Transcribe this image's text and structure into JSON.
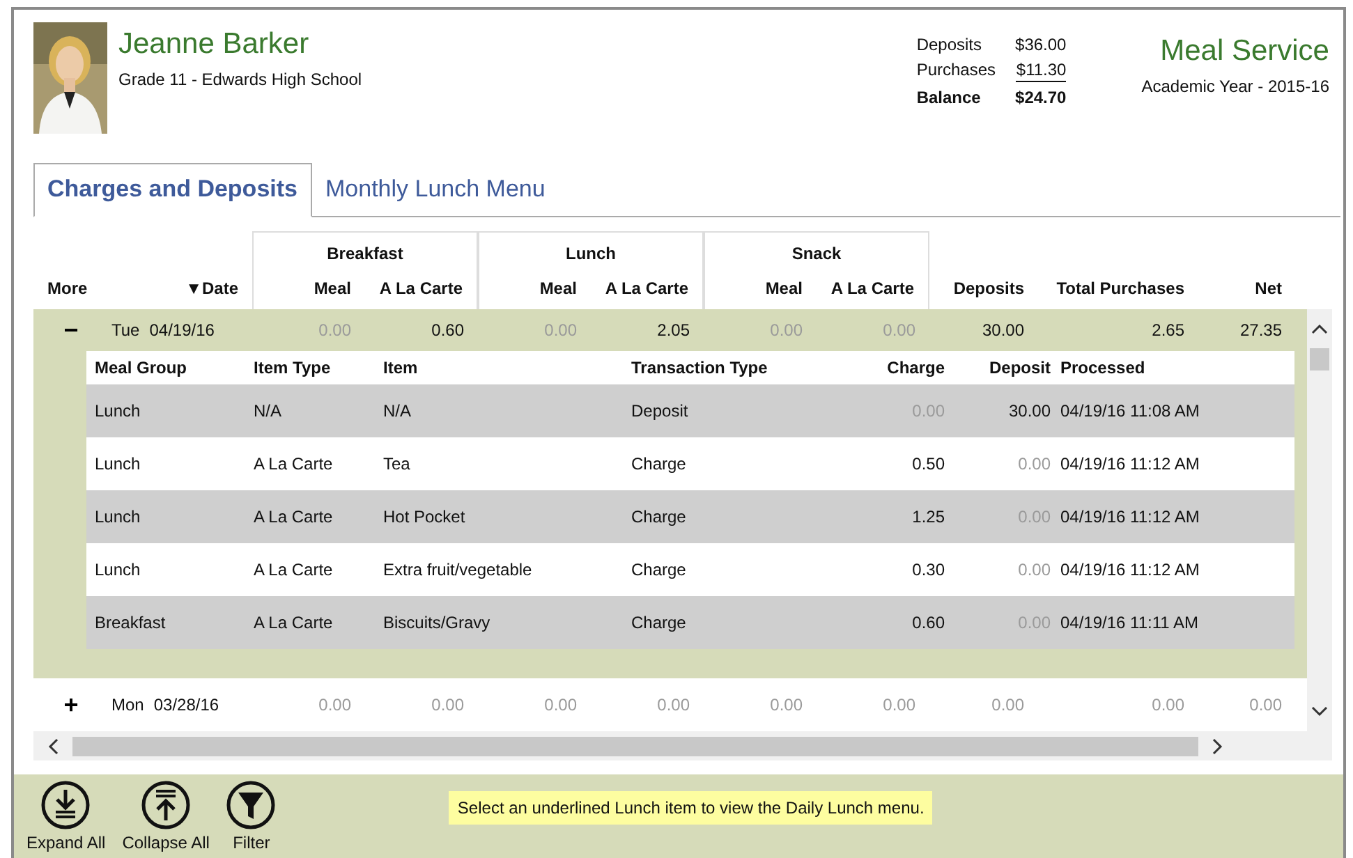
{
  "student": {
    "name": "Jeanne Barker",
    "subtitle": "Grade 11 - Edwards High School"
  },
  "summary": [
    {
      "label": "Deposits",
      "value": "$36.00",
      "underlined": false,
      "kind": "normal"
    },
    {
      "label": "Purchases",
      "value": "$11.30",
      "underlined": true,
      "kind": "normal"
    },
    {
      "label": "Balance",
      "value": "$24.70",
      "underlined": false,
      "kind": "total"
    }
  ],
  "app": {
    "title": "Meal Service",
    "subtitle": "Academic Year - 2015-16"
  },
  "tabs": [
    {
      "label": "Charges and Deposits",
      "selected": true
    },
    {
      "label": "Monthly Lunch Menu",
      "selected": false
    }
  ],
  "grid": {
    "groups": [
      "Breakfast",
      "Lunch",
      "Snack"
    ],
    "columns": [
      "More",
      "▼Date",
      "Meal",
      "A La Carte",
      "Meal",
      "A La Carte",
      "Meal",
      "A La Carte",
      "Deposits",
      "Total Purchases",
      "Net"
    ],
    "days": [
      {
        "toggle": "−",
        "expanded": true,
        "day": "Tue",
        "date": "04/19/16",
        "values": [
          {
            "v": "0.00",
            "muted": true
          },
          {
            "v": "0.60",
            "muted": false
          },
          {
            "v": "0.00",
            "muted": true
          },
          {
            "v": "2.05",
            "muted": false
          },
          {
            "v": "0.00",
            "muted": true
          },
          {
            "v": "0.00",
            "muted": true
          },
          {
            "v": "30.00",
            "muted": false
          },
          {
            "v": "2.65",
            "muted": false
          },
          {
            "v": "27.35",
            "muted": false
          }
        ],
        "detail_columns": [
          "Meal Group",
          "Item Type",
          "Item",
          "Transaction Type",
          "Charge",
          "Deposit",
          "Processed"
        ],
        "details": [
          {
            "group": "Lunch",
            "type": "N/A",
            "item": "N/A",
            "transaction": "Deposit",
            "charge": {
              "v": "0.00",
              "muted": true
            },
            "deposit": {
              "v": "30.00",
              "muted": false
            },
            "processed": "04/19/16 11:08 AM"
          },
          {
            "group": "Lunch",
            "type": "A La Carte",
            "item": "Tea",
            "transaction": "Charge",
            "charge": {
              "v": "0.50",
              "muted": false
            },
            "deposit": {
              "v": "0.00",
              "muted": true
            },
            "processed": "04/19/16 11:12 AM"
          },
          {
            "group": "Lunch",
            "type": "A La Carte",
            "item": "Hot Pocket",
            "transaction": "Charge",
            "charge": {
              "v": "1.25",
              "muted": false
            },
            "deposit": {
              "v": "0.00",
              "muted": true
            },
            "processed": "04/19/16 11:12 AM"
          },
          {
            "group": "Lunch",
            "type": "A La Carte",
            "item": "Extra fruit/vegetable",
            "transaction": "Charge",
            "charge": {
              "v": "0.30",
              "muted": false
            },
            "deposit": {
              "v": "0.00",
              "muted": true
            },
            "processed": "04/19/16 11:12 AM"
          },
          {
            "group": "Breakfast",
            "type": "A La Carte",
            "item": "Biscuits/Gravy",
            "transaction": "Charge",
            "charge": {
              "v": "0.60",
              "muted": false
            },
            "deposit": {
              "v": "0.00",
              "muted": true
            },
            "processed": "04/19/16 11:11 AM"
          }
        ]
      },
      {
        "toggle": "+",
        "expanded": false,
        "day": "Mon",
        "date": "03/28/16",
        "values": [
          {
            "v": "0.00",
            "muted": true
          },
          {
            "v": "0.00",
            "muted": true
          },
          {
            "v": "0.00",
            "muted": true
          },
          {
            "v": "0.00",
            "muted": true
          },
          {
            "v": "0.00",
            "muted": true
          },
          {
            "v": "0.00",
            "muted": true
          },
          {
            "v": "0.00",
            "muted": true
          },
          {
            "v": "0.00",
            "muted": true
          },
          {
            "v": "0.00",
            "muted": true
          }
        ]
      }
    ]
  },
  "toolbar": {
    "buttons": [
      {
        "label": "Expand All",
        "kind": "expand"
      },
      {
        "label": "Collapse All",
        "kind": "collapse"
      },
      {
        "label": "Filter",
        "kind": "filter"
      }
    ],
    "hint": "Select an underlined Lunch item to view the Daily Lunch menu."
  }
}
